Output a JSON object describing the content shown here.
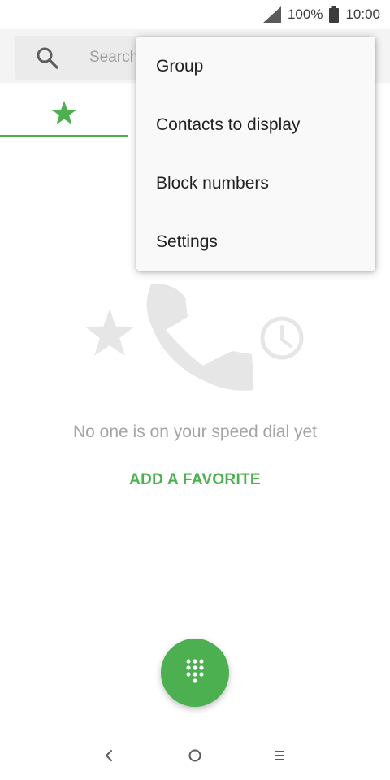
{
  "status_bar": {
    "battery_level": "100%",
    "time": "10:00",
    "signal_icon": "cell-signal-icon",
    "battery_icon": "battery-full-icon"
  },
  "search": {
    "placeholder": "Search",
    "icon": "search-icon"
  },
  "tabs": {
    "selected": "favorites",
    "favorites_icon": "star-icon"
  },
  "empty_state": {
    "message": "No one is on your speed dial yet",
    "action_label": "ADD A FAVORITE",
    "illustration_icons": [
      "star-icon",
      "phone-icon",
      "clock-icon"
    ]
  },
  "fab": {
    "icon": "dialpad-icon"
  },
  "overflow_menu": {
    "items": [
      {
        "label": "Group"
      },
      {
        "label": "Contacts to display"
      },
      {
        "label": "Block numbers"
      },
      {
        "label": "Settings"
      }
    ]
  },
  "nav_bar": {
    "back_icon": "back-icon",
    "home_icon": "home-icon",
    "recents_icon": "menu-icon"
  },
  "colors": {
    "accent": "#4caf50",
    "header_background": "#f4f4f4",
    "menu_background": "#f9f9f9",
    "illustration": "#e6e6e6",
    "muted_text": "#a4a4a4"
  }
}
